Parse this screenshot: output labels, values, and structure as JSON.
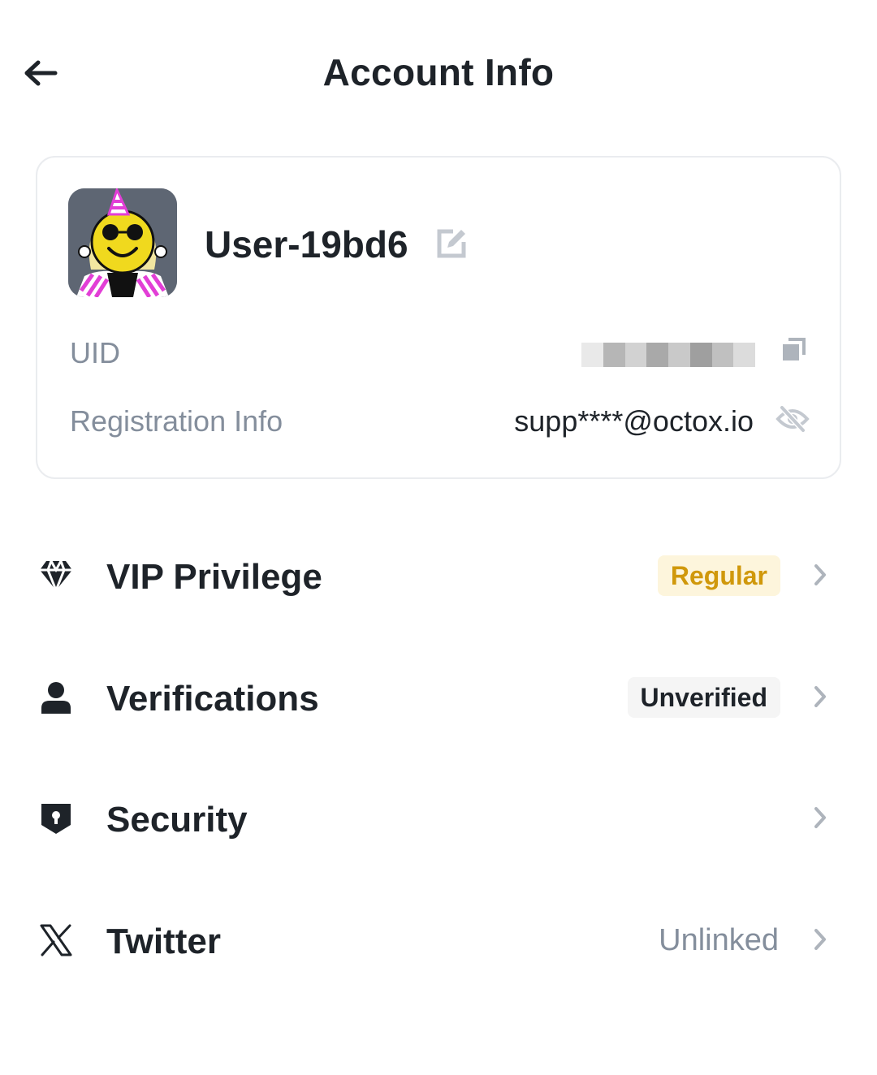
{
  "header": {
    "title": "Account Info",
    "back_icon": "arrow-left-icon"
  },
  "profile": {
    "username": "User-19bd6",
    "edit_icon": "edit-icon",
    "uid_label": "UID",
    "copy_icon": "copy-icon",
    "registration_label": "Registration Info",
    "registration_value": "supp****@octox.io",
    "visibility_icon": "eye-off-icon"
  },
  "menu": {
    "items": [
      {
        "label": "VIP Privilege",
        "icon": "diamond-icon",
        "badge": "Regular"
      },
      {
        "label": "Verifications",
        "icon": "person-icon",
        "badge": "Unverified"
      },
      {
        "label": "Security",
        "icon": "shield-icon"
      },
      {
        "label": "Twitter",
        "icon": "x-logo-icon",
        "status": "Unlinked"
      }
    ]
  },
  "colors": {
    "text_primary": "#1e2329",
    "text_secondary": "#848e9c",
    "vip_badge_bg": "#fdf5dc",
    "vip_badge_text": "#d0980b",
    "verify_badge_bg": "#f5f5f5",
    "card_border": "#eaecef"
  }
}
